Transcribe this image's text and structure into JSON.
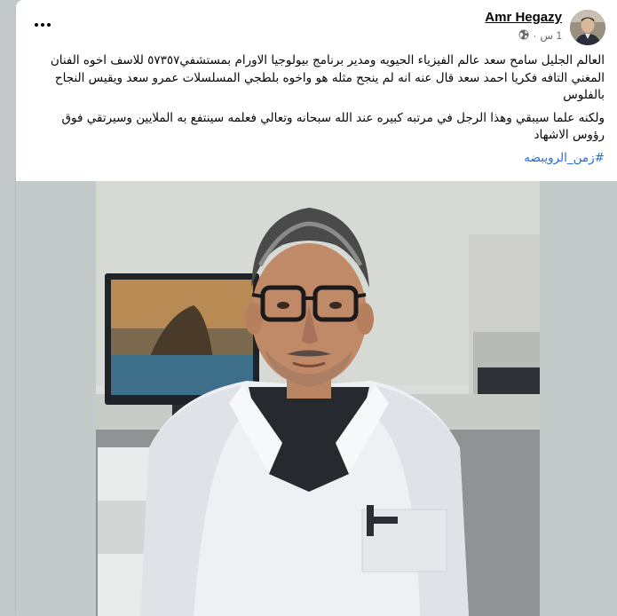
{
  "post": {
    "author": "Amr Hegazy",
    "time": "1 س",
    "separator": "·",
    "paragraph1": "العالم  الجليل سامح سعد عالم الفيزياء الحيويه ومدير  برنامج بيولوجيا الاورام بمستشفي٥٧٣٥٧ للاسف  اخوه الفنان المغني التافه فكريا احمد سعد قال عنه انه لم ينجح مثله هو واخوه بلطجي المسلسلات عمرو سعد ويقيس النجاح بالفلوس",
    "paragraph2": "ولكنه علما سيبقي وهذا الرجل في مرتبه كبيره عند الله سبحانه وتعالي فعلمه سينتفع  به الملايين وسيرتقي فوق رؤوس الاشهاد",
    "hashtag": "#زمن_الرويبضه"
  },
  "icons": {
    "more": "more-horizontal-icon",
    "audience": "globe-icon"
  },
  "colors": {
    "link": "#216fdb",
    "text": "#050505",
    "meta": "#65676b"
  }
}
